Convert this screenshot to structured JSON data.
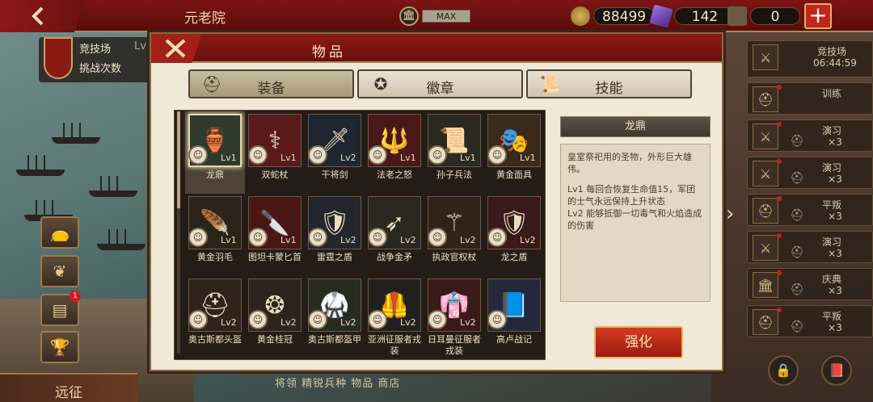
{
  "topbar": {
    "title": "元老院",
    "rank_label": "MAX",
    "coins": "88499",
    "gems": "142",
    "tokens": "0",
    "back_icon": "back-arrow-icon",
    "plus_label": "+"
  },
  "left": {
    "arena_title": "竞技场",
    "arena_lv": "Lv",
    "arena_sub": "挑战次数",
    "expedition_label": "远征",
    "bottom_nav": "将领   精锐兵种   物品   商店",
    "badge_count": "1"
  },
  "dialog": {
    "title": "物品",
    "tabs": [
      {
        "label": "装备",
        "icon": "helmet-icon",
        "active": true
      },
      {
        "label": "徽章",
        "icon": "eagle-emblem-icon",
        "active": false
      },
      {
        "label": "技能",
        "icon": "scroll-icon",
        "active": false
      }
    ],
    "items": [
      {
        "name": "龙鼎",
        "lv": "Lv1",
        "icon": "🏺",
        "bg": "#2f3a2c",
        "selected": true
      },
      {
        "name": "双蛇杖",
        "lv": "Lv1",
        "icon": "⚕",
        "bg": "#5a1a1a"
      },
      {
        "name": "干将剑",
        "lv": "Lv2",
        "icon": "🗡",
        "bg": "#1e2630"
      },
      {
        "name": "法老之怒",
        "lv": "Lv1",
        "icon": "🔱",
        "bg": "#4a1818"
      },
      {
        "name": "孙子兵法",
        "lv": "Lv1",
        "icon": "📜",
        "bg": "#2c2822"
      },
      {
        "name": "黄金面具",
        "lv": "Lv1",
        "icon": "🎭",
        "bg": "#3a2a1c"
      },
      {
        "name": "黄金羽毛",
        "lv": "Lv1",
        "icon": "🪶",
        "bg": "#2a2418"
      },
      {
        "name": "图坦卡蒙匕首",
        "lv": "Lv1",
        "icon": "🔪",
        "bg": "#4a1616"
      },
      {
        "name": "雷霆之盾",
        "lv": "Lv2",
        "icon": "🛡",
        "bg": "#23262c"
      },
      {
        "name": "战争金矛",
        "lv": "Lv2",
        "icon": "➶",
        "bg": "#2a2620"
      },
      {
        "name": "执政官权杖",
        "lv": "Lv2",
        "icon": "⚚",
        "bg": "#2e2418"
      },
      {
        "name": "龙之盾",
        "lv": "Lv2",
        "icon": "🛡",
        "bg": "#3a1a18"
      },
      {
        "name": "奥古斯都头盔",
        "lv": "Lv2",
        "icon": "⛑",
        "bg": "#2e241a"
      },
      {
        "name": "黄金桂冠",
        "lv": "Lv2",
        "icon": "❂",
        "bg": "#2a241c"
      },
      {
        "name": "奥古斯都盔甲",
        "lv": "Lv2",
        "icon": "🥋",
        "bg": "#262c22"
      },
      {
        "name": "亚洲征服者戎装",
        "lv": "Lv2",
        "icon": "🦺",
        "bg": "#22201e"
      },
      {
        "name": "日耳曼征服者戎装",
        "lv": "Lv2",
        "icon": "👘",
        "bg": "#3a1a18"
      },
      {
        "name": "高卢战记",
        "lv": "",
        "icon": "📘",
        "bg": "#24283a"
      }
    ],
    "detail": {
      "title": "龙鼎",
      "desc": "皇室祭祀用的圣物，外形巨大雄伟。",
      "lv1": "Lv1 每回合恢复生命值15，军团的士气永远保持上升状态",
      "lv2": "Lv2 能够抵御一切毒气和火焰造成的伤害"
    },
    "enhance_label": "强化"
  },
  "right": {
    "rows": [
      {
        "name": "竞技场",
        "sub": "06:44:59",
        "icon": "crossed-swords-icon"
      },
      {
        "name": "训练",
        "sub": "",
        "icon": "helmet-icon"
      },
      {
        "name": "演习",
        "sub": "×3",
        "icon": "swords-icon"
      },
      {
        "name": "演习",
        "sub": "×3",
        "icon": "swords-icon"
      },
      {
        "name": "平叛",
        "sub": "×3",
        "icon": "helmet-icon"
      },
      {
        "name": "演习",
        "sub": "×3",
        "icon": "swords-icon"
      },
      {
        "name": "庆典",
        "sub": "×3",
        "icon": "temple-icon"
      },
      {
        "name": "平叛",
        "sub": "×3",
        "icon": "helmet-icon"
      }
    ]
  }
}
